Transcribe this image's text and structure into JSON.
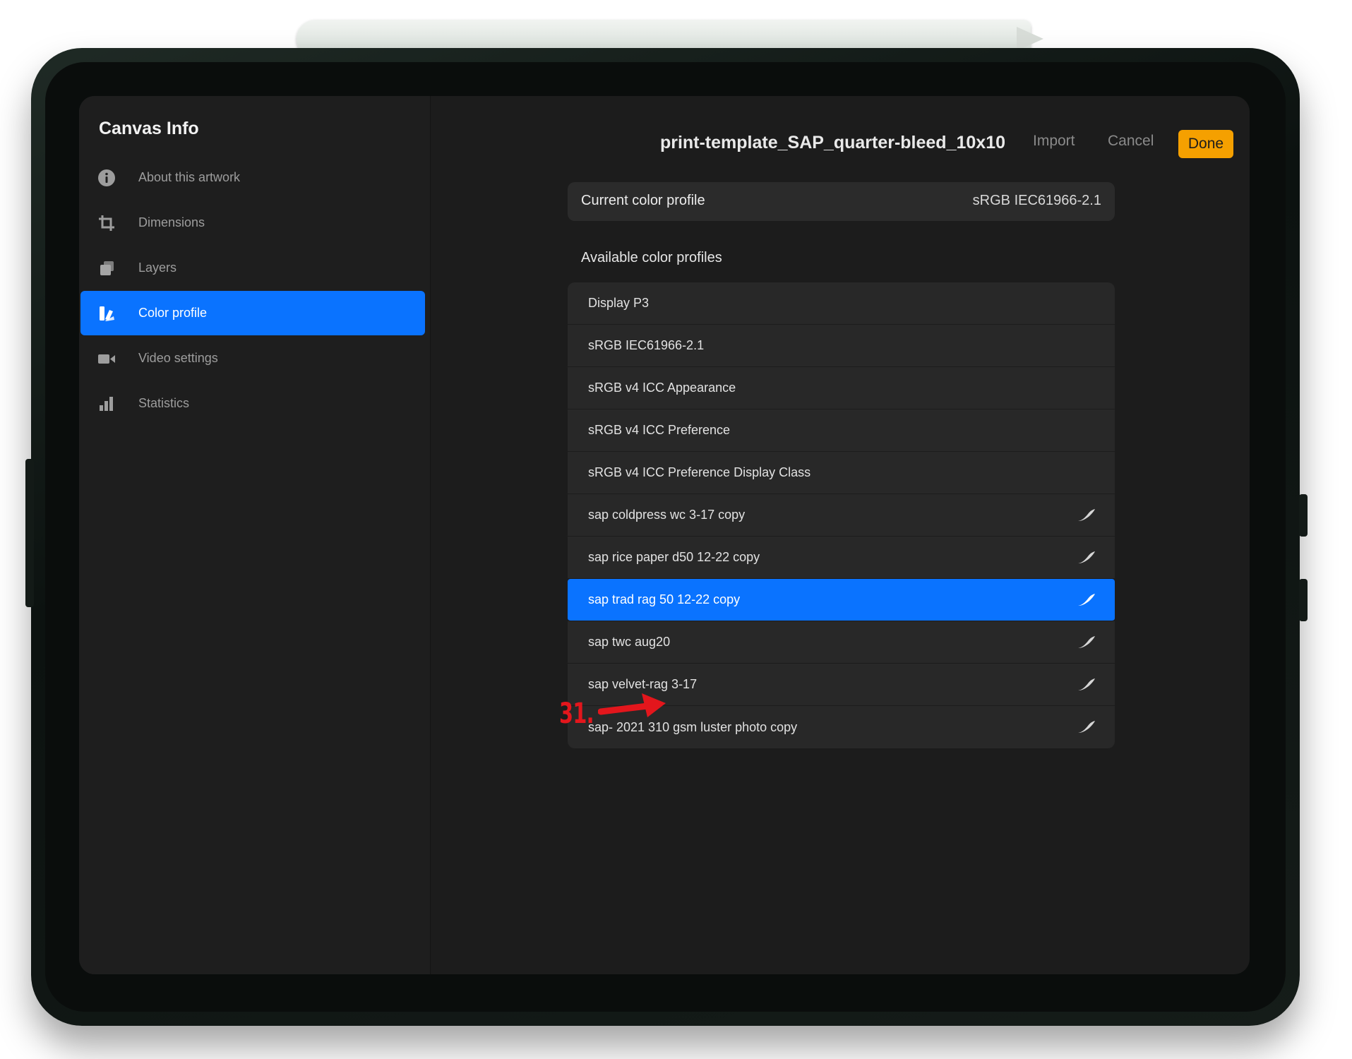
{
  "sidebar": {
    "title": "Canvas Info",
    "items": [
      {
        "label": "About this artwork",
        "icon": "info-icon"
      },
      {
        "label": "Dimensions",
        "icon": "crop-icon"
      },
      {
        "label": "Layers",
        "icon": "layers-icon"
      },
      {
        "label": "Color profile",
        "icon": "color-swatch-icon",
        "active": true
      },
      {
        "label": "Video settings",
        "icon": "video-camera-icon"
      },
      {
        "label": "Statistics",
        "icon": "bar-chart-icon"
      }
    ]
  },
  "header": {
    "document_title": "print-template_SAP_quarter-bleed_10x10",
    "import_label": "Import",
    "cancel_label": "Cancel",
    "done_label": "Done"
  },
  "current_profile": {
    "label": "Current color profile",
    "value": "sRGB IEC61966-2.1"
  },
  "available": {
    "heading": "Available color profiles",
    "profiles": [
      {
        "name": "Display P3",
        "custom": false
      },
      {
        "name": "sRGB IEC61966-2.1",
        "custom": false
      },
      {
        "name": "sRGB v4 ICC Appearance",
        "custom": false
      },
      {
        "name": "sRGB v4 ICC Preference",
        "custom": false
      },
      {
        "name": "sRGB v4 ICC Preference Display Class",
        "custom": false
      },
      {
        "name": "sap coldpress wc 3-17 copy",
        "custom": true
      },
      {
        "name": "sap rice paper d50 12-22 copy",
        "custom": true
      },
      {
        "name": "sap trad rag 50 12-22 copy",
        "custom": true,
        "selected": true
      },
      {
        "name": "sap twc aug20",
        "custom": true
      },
      {
        "name": "sap velvet-rag 3-17",
        "custom": true
      },
      {
        "name": "sap- 2021 310 gsm luster photo copy",
        "custom": true
      }
    ]
  },
  "annotation": {
    "label": "31.",
    "color": "#e3161c"
  },
  "colors": {
    "accent": "#0a73ff",
    "done_button": "#f5a000",
    "background": "#1c1c1c"
  }
}
